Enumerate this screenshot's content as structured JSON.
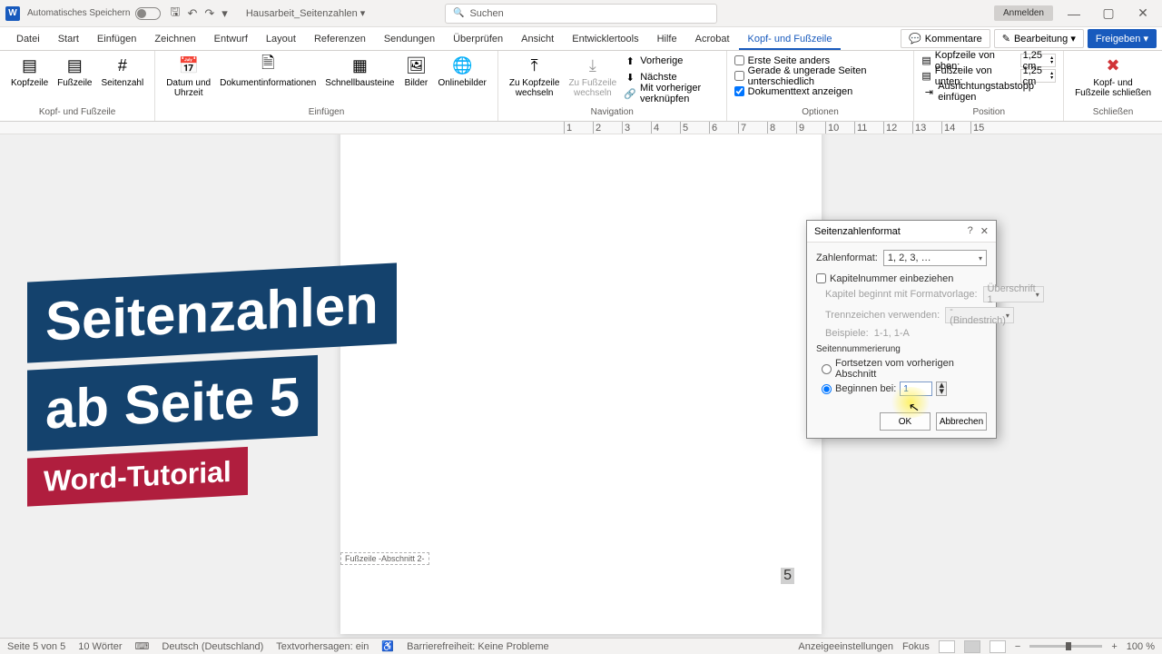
{
  "titlebar": {
    "autosave": "Automatisches Speichern",
    "doc_title": "Hausarbeit_Seitenzahlen ▾",
    "search_placeholder": "Suchen",
    "signin": "Anmelden"
  },
  "tabs": {
    "items": [
      "Datei",
      "Start",
      "Einfügen",
      "Zeichnen",
      "Entwurf",
      "Layout",
      "Referenzen",
      "Sendungen",
      "Überprüfen",
      "Ansicht",
      "Entwicklertools",
      "Hilfe",
      "Acrobat",
      "Kopf- und Fußzeile"
    ],
    "active_index": 13,
    "kommentare": "Kommentare",
    "bearbeitung": "Bearbeitung ▾",
    "freigeben": "Freigeben ▾"
  },
  "ribbon": {
    "g1": {
      "kopf": "Kopfzeile",
      "fuss": "Fußzeile",
      "seiten": "Seitenzahl",
      "label": "Kopf- und Fußzeile"
    },
    "g2": {
      "datum": "Datum und\nUhrzeit",
      "dokinfo": "Dokumentinformationen",
      "schnell": "Schnellbausteine",
      "bilder": "Bilder",
      "online": "Onlinebilder",
      "label": "Einfügen"
    },
    "g3": {
      "zukopf": "Zu Kopfzeile\nwechseln",
      "zufuss": "Zu Fußzeile\nwechseln",
      "vorh": "Vorherige",
      "naech": "Nächste",
      "verkn": "Mit vorheriger verknüpfen",
      "label": "Navigation"
    },
    "g4": {
      "erste": "Erste Seite anders",
      "gerade": "Gerade & ungerade Seiten unterschiedlich",
      "doktext": "Dokumenttext anzeigen",
      "label": "Optionen"
    },
    "g5": {
      "oben": "Kopfzeile von oben:",
      "unten": "Fußzeile von unten:",
      "oben_val": "1,25 cm",
      "unten_val": "1,25 cm",
      "tabstopp": "Ausrichtungstabstopp einfügen",
      "label": "Position"
    },
    "g6": {
      "close": "Kopf- und\nFußzeile schließen",
      "label": "Schließen"
    }
  },
  "ruler": {
    "marks": [
      "1",
      "2",
      "3",
      "4",
      "5",
      "6",
      "7",
      "8",
      "9",
      "10",
      "11",
      "12",
      "13",
      "14",
      "15"
    ]
  },
  "page": {
    "footer_tag": "Fußzeile -Abschnitt 2-",
    "page_num": "5"
  },
  "overlay": {
    "line1": "Seitenzahlen",
    "line2": "ab Seite 5",
    "line3": "Word-Tutorial"
  },
  "dialog": {
    "title": "Seitenzahlenformat",
    "zahlenformat_lbl": "Zahlenformat:",
    "zahlenformat_val": "1, 2, 3, …",
    "kapitel_chk": "Kapitelnummer einbeziehen",
    "kapitel_beginnt": "Kapitel beginnt mit Formatvorlage:",
    "kapitel_beginnt_val": "Überschrift 1",
    "trenn": "Trennzeichen verwenden:",
    "trenn_val": "-  (Bindestrich)",
    "beispiele": "Beispiele:",
    "beispiele_val": "1-1, 1-A",
    "seitennum": "Seitennummerierung",
    "fortsetzen": "Fortsetzen vom vorherigen Abschnitt",
    "beginnen": "Beginnen bei:",
    "beginnen_val": "1",
    "ok": "OK",
    "abbrechen": "Abbrechen"
  },
  "status": {
    "seite": "Seite 5 von 5",
    "woerter": "10 Wörter",
    "sprache": "Deutsch (Deutschland)",
    "textvor": "Textvorhersagen: ein",
    "barriere": "Barrierefreiheit: Keine Probleme",
    "anzeige": "Anzeigeeinstellungen",
    "fokus": "Fokus",
    "zoom": "100 %"
  }
}
